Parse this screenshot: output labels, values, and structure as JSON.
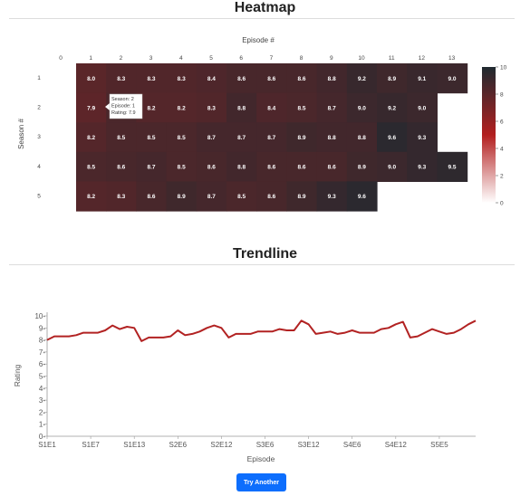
{
  "heatmap": {
    "title": "Heatmap",
    "x_axis_label": "Episode #",
    "y_axis_label": "Season #",
    "episodes": [
      "0",
      "1",
      "2",
      "3",
      "4",
      "5",
      "6",
      "7",
      "8",
      "9",
      "10",
      "11",
      "12",
      "13"
    ],
    "seasons": [
      "1",
      "2",
      "3",
      "4",
      "5"
    ],
    "tooltip": {
      "season": "Season: 2",
      "episode": "Episode: 1",
      "rating": "Rating: 7.9"
    },
    "colorbar_ticks": [
      "10",
      "8",
      "6",
      "4",
      "2",
      "0"
    ],
    "colors": {
      "low": "#ffffff",
      "mid": "#b21f1f",
      "high": "#1f2a30"
    }
  },
  "trendline": {
    "title": "Trendline",
    "x_axis_label": "Episode",
    "y_axis_label": "Rating",
    "line_color": "#b22222"
  },
  "button": {
    "label": "Try Another"
  },
  "chart_data": [
    {
      "type": "heatmap",
      "title": "Heatmap",
      "xlabel": "Episode #",
      "ylabel": "Season #",
      "x": [
        1,
        2,
        3,
        4,
        5,
        6,
        7,
        8,
        9,
        10,
        11,
        12,
        13
      ],
      "y": [
        1,
        2,
        3,
        4,
        5
      ],
      "values": [
        [
          8.0,
          8.3,
          8.3,
          8.3,
          8.4,
          8.6,
          8.6,
          8.6,
          8.8,
          9.2,
          8.9,
          9.1,
          9.0
        ],
        [
          7.9,
          8.5,
          8.2,
          8.2,
          8.3,
          8.8,
          8.4,
          8.5,
          8.7,
          9.0,
          9.2,
          9.0,
          null
        ],
        [
          8.2,
          8.5,
          8.5,
          8.5,
          8.7,
          8.7,
          8.7,
          8.9,
          8.8,
          8.8,
          9.6,
          9.3,
          null
        ],
        [
          8.5,
          8.6,
          8.7,
          8.5,
          8.6,
          8.8,
          8.6,
          8.6,
          8.6,
          8.9,
          9.0,
          9.3,
          9.5
        ],
        [
          8.2,
          8.3,
          8.6,
          8.9,
          8.7,
          8.5,
          8.6,
          8.9,
          9.3,
          9.6,
          null,
          null,
          null
        ]
      ],
      "zlim": [
        0,
        10
      ]
    },
    {
      "type": "line",
      "title": "Trendline",
      "xlabel": "Episode",
      "ylabel": "Rating",
      "ylim": [
        0,
        10
      ],
      "x_tick_labels": [
        "S1E1",
        "S1E7",
        "S1E13",
        "S2E6",
        "S2E12",
        "S3E6",
        "S3E12",
        "S4E6",
        "S4E12",
        "S5E5"
      ],
      "y_tick_labels": [
        "0",
        "1",
        "2",
        "3",
        "4",
        "5",
        "6",
        "7",
        "8",
        "9",
        "10"
      ],
      "series": [
        {
          "values": [
            8.0,
            8.3,
            8.3,
            8.3,
            8.4,
            8.6,
            8.6,
            8.6,
            8.8,
            9.2,
            8.9,
            9.1,
            9.0,
            7.9,
            8.2,
            8.2,
            8.2,
            8.3,
            8.8,
            8.4,
            8.5,
            8.7,
            9.0,
            9.2,
            9.0,
            8.2,
            8.5,
            8.5,
            8.5,
            8.7,
            8.7,
            8.7,
            8.9,
            8.8,
            8.8,
            9.6,
            9.3,
            8.5,
            8.6,
            8.7,
            8.5,
            8.6,
            8.8,
            8.6,
            8.6,
            8.6,
            8.9,
            9.0,
            9.3,
            9.5,
            8.2,
            8.3,
            8.6,
            8.9,
            8.7,
            8.5,
            8.6,
            8.9,
            9.3,
            9.6
          ]
        }
      ]
    }
  ]
}
